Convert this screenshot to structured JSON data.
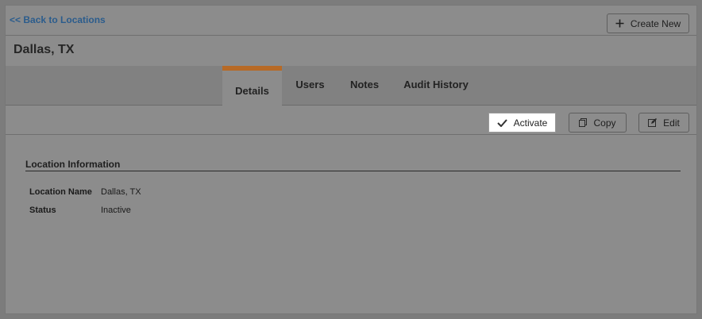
{
  "nav": {
    "back_label": "<< Back to Locations",
    "create_label": "Create New"
  },
  "page": {
    "title": "Dallas, TX"
  },
  "tabs": [
    {
      "label": "Details",
      "active": true
    },
    {
      "label": "Users",
      "active": false
    },
    {
      "label": "Notes",
      "active": false
    },
    {
      "label": "Audit History",
      "active": false
    }
  ],
  "actions": {
    "activate_label": "Activate",
    "copy_label": "Copy",
    "edit_label": "Edit"
  },
  "section": {
    "heading": "Location Information",
    "fields": [
      {
        "label": "Location Name",
        "value": "Dallas, TX"
      },
      {
        "label": "Status",
        "value": "Inactive"
      }
    ]
  },
  "colors": {
    "accent_tab": "#b76a26",
    "link": "#2b5c8c",
    "overlay_background": "#8c8c8c"
  },
  "icons": {
    "create": "plus-icon",
    "activate": "checkmark-icon",
    "copy": "copy-icon",
    "edit": "edit-icon"
  }
}
